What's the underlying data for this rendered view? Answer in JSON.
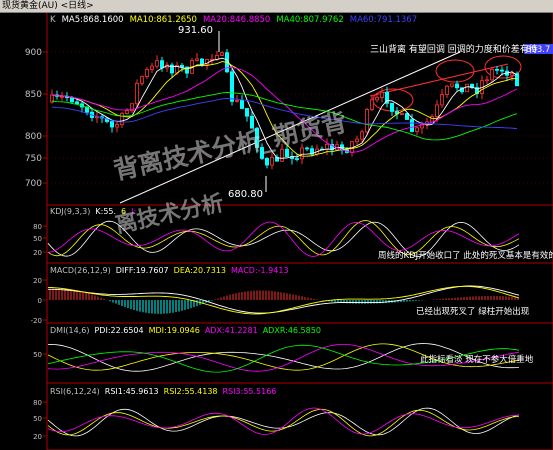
{
  "window": {
    "title": "现货黄金(AU) <日线>"
  },
  "price_panel": {
    "label": "K",
    "ma_items": [
      {
        "text": "MA5:868.1600",
        "color": "#ffffff"
      },
      {
        "text": "MA10:861.2650",
        "color": "#ffff00"
      },
      {
        "text": "MA20:846.8850",
        "color": "#ff00ff"
      },
      {
        "text": "MA40:807.9762",
        "color": "#00ff00"
      },
      {
        "text": "MA60:791.1367",
        "color": "#4040ff"
      }
    ],
    "y_ticks": [
      "900",
      "850",
      "800",
      "750",
      "700"
    ],
    "high_label": "931.60",
    "low_label": "680.80",
    "price_tag": "893.7",
    "annotation": "三山背离 有望回调  回调的力度和价差有待"
  },
  "kdj_panel": {
    "header": [
      {
        "text": "KDJ(9,3,3)",
        "color": "#c0c0c0"
      },
      {
        "text": "K:55.",
        "color": "#ffffff"
      },
      {
        "text": "6",
        "color": "#ffff00"
      },
      {
        "text": "J:",
        "color": "#ff00ff"
      }
    ],
    "y_ticks": [
      "80",
      "50",
      "20"
    ],
    "annotation": "周线的KDJ开始收口了  此处的死叉基本是有效的"
  },
  "macd_panel": {
    "header": [
      {
        "text": "MACD(26,12,9)",
        "color": "#c0c0c0"
      },
      {
        "text": "DIFF:19.7607",
        "color": "#ffffff"
      },
      {
        "text": "DEA:20.7313",
        "color": "#ffff00"
      },
      {
        "text": "MACD:-1.9413",
        "color": "#ff00ff"
      }
    ],
    "y_ticks": [
      "20",
      "0",
      "-20"
    ],
    "annotation": "已经出现死叉了 绿柱开始出现"
  },
  "dmi_panel": {
    "header": [
      {
        "text": "DMI(14,6)",
        "color": "#c0c0c0"
      },
      {
        "text": "PDI:22.6504",
        "color": "#ffffff"
      },
      {
        "text": "MDI:19.0946",
        "color": "#ffff00"
      },
      {
        "text": "ADX:41.2281",
        "color": "#ff00ff"
      },
      {
        "text": "ADXR:46.5850",
        "color": "#00ff00"
      }
    ],
    "y_ticks": [
      "50"
    ],
    "annotation": "此指标看淡  现在不参大倍重地"
  },
  "rsi_panel": {
    "header": [
      {
        "text": "RSI(6,12,24)",
        "color": "#c0c0c0"
      },
      {
        "text": "RSI1:45.9613",
        "color": "#ffffff"
      },
      {
        "text": "RSI2:55.4138",
        "color": "#ffff00"
      },
      {
        "text": "RSI3:55.5166",
        "color": "#ff00ff"
      }
    ],
    "y_ticks": [
      "80",
      "50",
      "20"
    ]
  },
  "watermark": {
    "line1": "背离技术分析_期货背",
    "line2": "离技术分析"
  },
  "colors": {
    "up": "#ff3030",
    "down": "#00ffff",
    "frame": "#b00000",
    "text": "#c0c0c0",
    "label": "#ffffff"
  }
}
